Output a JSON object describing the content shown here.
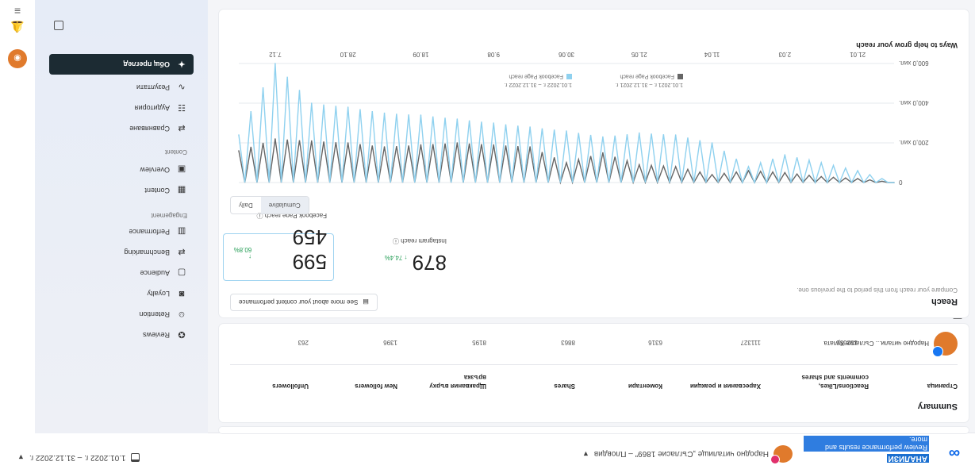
{
  "brand": {
    "title": "АНАЛИЗИ",
    "subtitle": "Review performance results and more."
  },
  "topbar": {
    "page_name": "Народно читалище „Съгласие 1869\" – Пловдив",
    "date_range": "1.01.2022 г. – 31.12.2022 г."
  },
  "nav": {
    "active": "Общ преглед",
    "items": [
      {
        "label": "Резултати",
        "icon": "pulse-icon"
      },
      {
        "label": "Аудитория",
        "icon": "audience-icon"
      },
      {
        "label": "Сравняване",
        "icon": "compare-icon"
      }
    ],
    "sections": [
      {
        "title": "Content",
        "items": [
          {
            "label": "Overview",
            "icon": "overview-icon"
          },
          {
            "label": "Content",
            "icon": "grid-icon"
          }
        ]
      },
      {
        "title": "Engagement",
        "items": [
          {
            "label": "Performance",
            "icon": "performance-icon"
          },
          {
            "label": "Benchmarking",
            "icon": "benchmark-icon"
          },
          {
            "label": "Audience",
            "icon": "audience-icon"
          },
          {
            "label": "Loyalty",
            "icon": "loyalty-icon"
          },
          {
            "label": "Retention",
            "icon": "retention-icon"
          },
          {
            "label": "Reviews",
            "icon": "reviews-icon"
          }
        ]
      }
    ]
  },
  "summary": {
    "title": "Summary",
    "headers": [
      "Страница",
      "Reactions/Likes, comments and shares",
      "Харесвания и реакции",
      "Коментари",
      "Shares",
      "Щраквания върху връзка",
      "New followers",
      "Unfollowers"
    ],
    "page_label": "Народно читали... Съгласие Кулата",
    "values": [
      "152636",
      "111327",
      "6316",
      "8863",
      "8195",
      "1396",
      "263"
    ]
  },
  "reach": {
    "title": "Reach",
    "subtitle": "Compare your reach from this period to the previous one.",
    "see_more": "See more about your content performance",
    "metrics": [
      {
        "value": "599 459",
        "delta": "↑ 60.8%",
        "label": "Facebook Page reach"
      },
      {
        "value": "879",
        "delta": "↑ 74.4%",
        "label": "Instagram reach"
      }
    ],
    "toggle": [
      "Daily",
      "Cumulative"
    ],
    "toggle_active": "Cumulative"
  },
  "chart_data": {
    "type": "line",
    "title": "Ways to help grow your reach",
    "x": [
      "1.01",
      "21.01",
      "9.02",
      "2.03",
      "22.03",
      "11.04",
      "1.05",
      "21.05",
      "10.06",
      "30.06",
      "20.07",
      "9.08",
      "29.08",
      "18.09",
      "8.10",
      "28.10",
      "17.11",
      "7.12",
      "31.12"
    ],
    "series": [
      {
        "name": "Facebook Page reach",
        "range": "1.01.2022 г. – 31.12.2022 г.",
        "color": "#8fd1ef",
        "values": [
          0,
          -60000,
          -100000,
          -140000,
          -80000,
          -200000,
          -240000,
          -250000,
          -230000,
          -260000,
          -280000,
          -300000,
          -320000,
          -340000,
          -350000,
          -380000,
          -400000,
          -600000,
          -240000
        ]
      },
      {
        "name": "Facebook Page reach",
        "range": "1.01.2021 г. – 31.12.2021 г.",
        "color": "#666666",
        "values": [
          0,
          -20000,
          -30000,
          -50000,
          -60000,
          -40000,
          -80000,
          -90000,
          -150000,
          -100000,
          -180000,
          -190000,
          -200000,
          -190000,
          -180000,
          -200000,
          -210000,
          -220000,
          -160000
        ]
      }
    ],
    "y_ticks": [
      "0",
      "200,0 хил.",
      "400,0 хил.",
      "600,0 хил."
    ],
    "x_ticks": [
      "21.01",
      "2.03",
      "11.04",
      "21.05",
      "30.06",
      "9.08",
      "18.09",
      "28.10",
      "7.12"
    ],
    "ylim": [
      -600000,
      0
    ]
  }
}
